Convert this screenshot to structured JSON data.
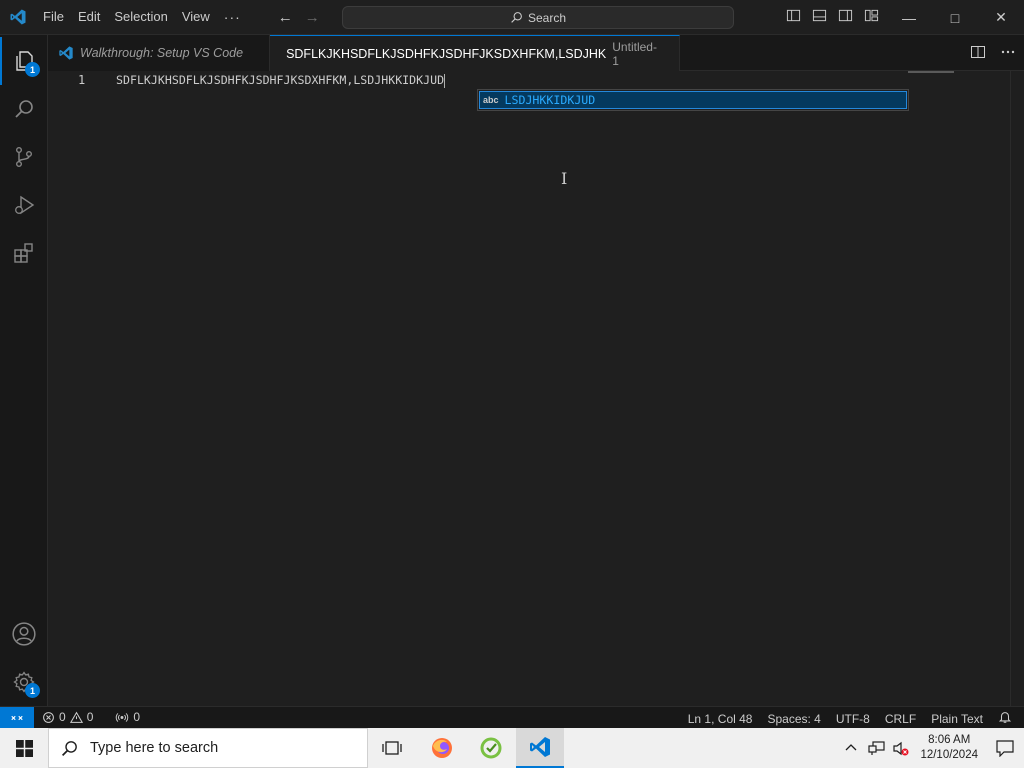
{
  "menu": {
    "items": [
      "File",
      "Edit",
      "Selection",
      "View"
    ],
    "more": "···"
  },
  "search": {
    "label": "Search"
  },
  "activity": {
    "explorer_badge": "1",
    "manage_badge": "1"
  },
  "tabs": [
    {
      "label": "Walkthrough: Setup VS Code",
      "preview": true
    },
    {
      "label": "SDFLKJKHSDFLKJSDHFKJSDHFJKSDXHFKM,LSDJHK",
      "description": "Untitled-1",
      "dirty": true
    }
  ],
  "editor": {
    "line_number": "1",
    "line_text": "SDFLKJKHSDFLKJSDHFKJSDHFJKSDXHFKM,LSDJHKKIDKJUD",
    "suggestion": {
      "kind": "abc",
      "label": "LSDJHKKIDKJUD"
    }
  },
  "statusbar": {
    "errors": "0",
    "warnings": "0",
    "ports": "0",
    "position": "Ln 1, Col 48",
    "indent": "Spaces: 4",
    "encoding": "UTF-8",
    "eol": "CRLF",
    "language": "Plain Text"
  },
  "taskbar": {
    "search_placeholder": "Type here to search",
    "time": "8:06 AM",
    "date": "12/10/2024"
  },
  "colors": {
    "accent": "#0078d4",
    "editor_bg": "#1f1f1f",
    "sidebar_bg": "#181818",
    "suggest_highlight": "#2aaaff"
  }
}
